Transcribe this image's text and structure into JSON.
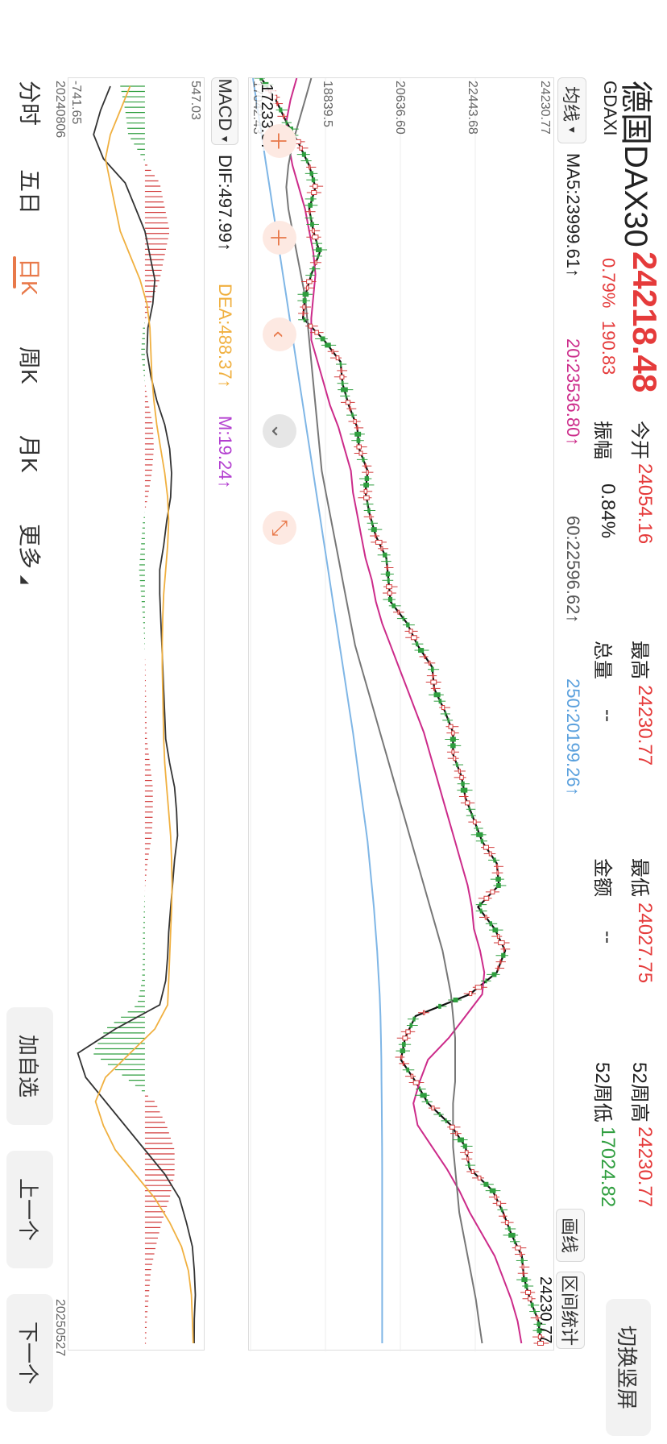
{
  "header": {
    "name": "德国DAX30",
    "price": "24218.48",
    "code": "GDAXI",
    "change_pct": "0.79%",
    "change": "190.83",
    "today_open_label": "今开",
    "today_open": "24054.16",
    "amplitude_label": "振幅",
    "amplitude": "0.84%",
    "high_label": "最高",
    "high": "24230.77",
    "volume_label": "总量",
    "volume": "--",
    "low_label": "最低",
    "low": "24027.75",
    "amount_label": "金额",
    "amount": "--",
    "wk52_high_label": "52周高",
    "wk52_high": "24230.77",
    "wk52_low_label": "52周低",
    "wk52_low": "17024.82",
    "switch_button": "切换竖屏"
  },
  "ma_bar": {
    "selector": "均线",
    "ma5": "MA5:23999.61↑",
    "ma20": "20:23536.80↑",
    "ma60": "60:22596.62↑",
    "ma250": "250:20199.26↑",
    "draw_button": "画线",
    "range_button": "区间统计"
  },
  "price_axis": [
    "24230.77",
    "22443.68",
    "20636.60",
    "18839.5",
    "17042.43"
  ],
  "current_label": "24230.77",
  "crosshair_label": "17233.07",
  "macd_bar": {
    "selector": "MACD",
    "dif": "DIF:497.99↑",
    "dea": "DEA:488.37↑",
    "m": "M:19.24↑"
  },
  "macd_axis": [
    "547.03",
    "-741.65"
  ],
  "dates": {
    "start": "20240806",
    "end": "20250527"
  },
  "tabs": [
    "分时",
    "五日",
    "日K",
    "周K",
    "月K",
    "更多"
  ],
  "side_buttons": {
    "add": "加自选",
    "prev": "上一个",
    "next": "下一个"
  },
  "chart_data": {
    "type": "candlestick",
    "x_range": [
      "20240806",
      "20250527"
    ],
    "ylim": [
      17042.43,
      24230.77
    ],
    "ma_lines": [
      {
        "name": "MA5",
        "color": "#111111",
        "values": [
          17300,
          17650,
          17900,
          18200,
          18450,
          18600,
          18450,
          18550,
          18700,
          18500,
          18350,
          18300,
          18800,
          19200,
          19250,
          19400,
          19600,
          19650,
          19850,
          19800,
          19900,
          20050,
          20300,
          20350,
          20400,
          20800,
          21050,
          21400,
          21450,
          21700,
          21900,
          21900,
          22100,
          22200,
          22400,
          22600,
          22950,
          23000,
          22500,
          22900,
          23150,
          22950,
          22300,
          21000,
          20750,
          20650,
          21000,
          21300,
          21850,
          22200,
          22300,
          22850,
          23100,
          23300,
          23550,
          23600,
          23750,
          23950,
          24000
        ]
      },
      {
        "name": "MA20",
        "color": "#cc2b8a",
        "values": [
          18150,
          18000,
          17900,
          17950,
          18050,
          18200,
          18350,
          18450,
          18550,
          18600,
          18550,
          18500,
          18500,
          18650,
          18800,
          18950,
          19150,
          19300,
          19450,
          19500,
          19600,
          19700,
          19800,
          19950,
          20050,
          20200,
          20400,
          20600,
          20800,
          21000,
          21200,
          21350,
          21500,
          21650,
          21800,
          21950,
          22100,
          22250,
          22350,
          22400,
          22550,
          22650,
          22600,
          22200,
          21800,
          21300,
          21100,
          20950,
          21050,
          21400,
          21750,
          22050,
          22300,
          22600,
          22900,
          23100,
          23300,
          23450,
          23540
        ]
      },
      {
        "name": "MA60",
        "color": "#777777",
        "values": [
          18500,
          18350,
          18200,
          18050,
          17950,
          17900,
          17950,
          18050,
          18150,
          18250,
          18350,
          18400,
          18450,
          18500,
          18550,
          18600,
          18650,
          18700,
          18750,
          18850,
          18950,
          19050,
          19150,
          19250,
          19350,
          19450,
          19550,
          19700,
          19850,
          20000,
          20150,
          20300,
          20450,
          20600,
          20750,
          20900,
          21050,
          21200,
          21350,
          21500,
          21650,
          21750,
          21850,
          21900,
          21950,
          21950,
          21950,
          21900,
          21900,
          21900,
          21950,
          22000,
          22050,
          22150,
          22250,
          22350,
          22450,
          22520,
          22597
        ]
      },
      {
        "name": "MA250",
        "color": "#7fb6e6",
        "values": [
          17100,
          17180,
          17260,
          17340,
          17420,
          17500,
          17580,
          17660,
          17740,
          17820,
          17900,
          17980,
          18060,
          18140,
          18220,
          18300,
          18380,
          18460,
          18540,
          18620,
          18700,
          18780,
          18860,
          18940,
          19020,
          19100,
          19180,
          19260,
          19340,
          19420,
          19500,
          19570,
          19640,
          19710,
          19780,
          19850,
          19900,
          19950,
          20000,
          20040,
          20080,
          20110,
          20140,
          20160,
          20170,
          20180,
          20185,
          20190,
          20195,
          20198,
          20199,
          20199,
          20199,
          20199,
          20199,
          20199,
          20199,
          20199,
          20199
        ]
      }
    ],
    "macd": {
      "ylim": [
        -741.65,
        547.03
      ],
      "dif": [
        -350,
        -450,
        -520,
        -420,
        -200,
        -100,
        0,
        50,
        100,
        80,
        30,
        20,
        60,
        120,
        200,
        250,
        270,
        260,
        220,
        190,
        150,
        150,
        160,
        170,
        180,
        190,
        200,
        210,
        250,
        300,
        320,
        330,
        300,
        280,
        260,
        240,
        230,
        210,
        150,
        -300,
        -680,
        -600,
        -400,
        -200,
        0,
        200,
        350,
        420,
        480,
        500,
        510,
        500,
        498
      ],
      "dea": [
        -150,
        -250,
        -350,
        -400,
        -350,
        -300,
        -250,
        -150,
        -50,
        20,
        50,
        60,
        70,
        90,
        120,
        160,
        200,
        230,
        240,
        230,
        210,
        190,
        180,
        175,
        175,
        180,
        185,
        190,
        200,
        220,
        240,
        260,
        270,
        275,
        270,
        260,
        250,
        240,
        230,
        100,
        -150,
        -400,
        -500,
        -420,
        -300,
        -100,
        100,
        250,
        370,
        440,
        470,
        480,
        488
      ],
      "hist": [
        -250,
        -200,
        -170,
        -20,
        150,
        200,
        250,
        200,
        150,
        60,
        -20,
        -40,
        -10,
        30,
        80,
        90,
        70,
        30,
        -20,
        -40,
        -60,
        -40,
        -20,
        -5,
        5,
        10,
        15,
        20,
        50,
        80,
        80,
        70,
        30,
        5,
        -10,
        -20,
        -20,
        -30,
        -80,
        -400,
        -530,
        -200,
        100,
        220,
        300,
        300,
        250,
        170,
        110,
        60,
        40,
        20,
        10
      ]
    }
  }
}
